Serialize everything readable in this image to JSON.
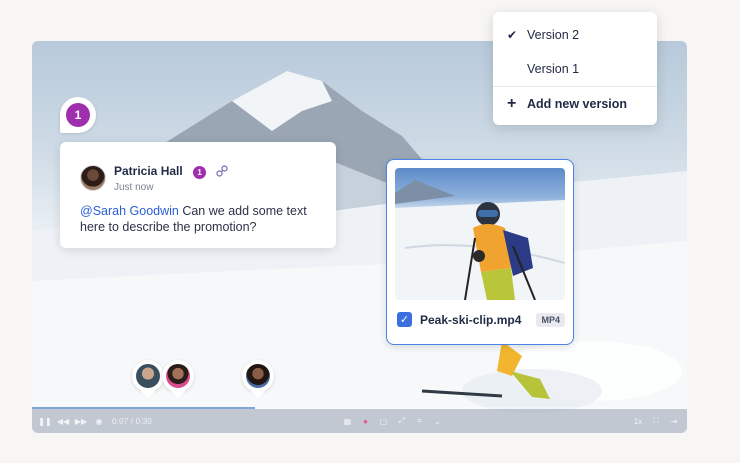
{
  "player": {
    "time": "0:07 / 0:30",
    "speed": "1x",
    "progress": 0.34
  },
  "comment_badge": {
    "number": "1"
  },
  "comment": {
    "author": "Patricia Hall",
    "timestamp": "Just now",
    "badge": "1",
    "mention": "@Sarah Goodwin",
    "text": " Can we add some text here to describe the promotion?"
  },
  "version_menu": {
    "items": [
      {
        "label": "Version 2",
        "checked": true
      },
      {
        "label": "Version 1",
        "checked": false
      }
    ],
    "add_label": "Add new version"
  },
  "file_card": {
    "name": "Peak-ski-clip.mp4",
    "type": "MP4",
    "checked": true
  },
  "colors": {
    "accent": "#3b6fe0",
    "comment_badge": "#a02fae",
    "mention": "#2c5fd6"
  }
}
